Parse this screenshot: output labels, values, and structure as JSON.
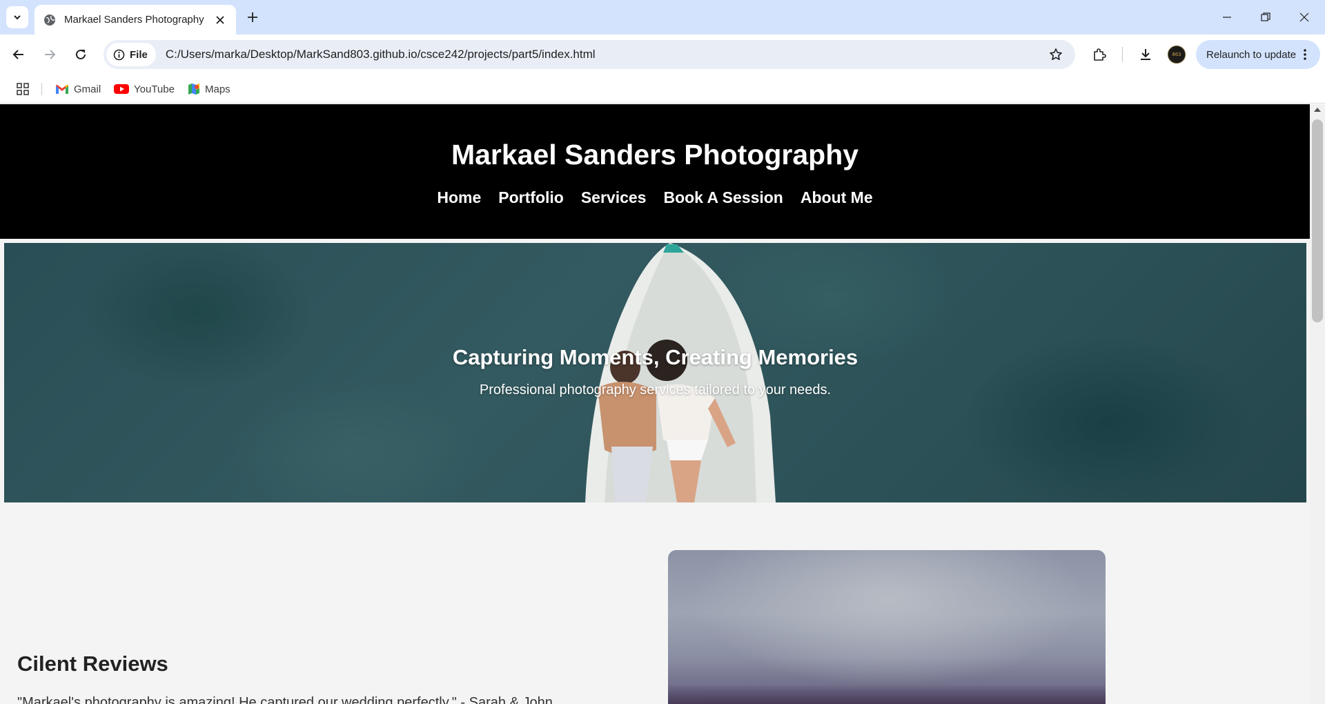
{
  "browser": {
    "tab_title": "Markael Sanders Photography",
    "site_chip_label": "File",
    "url": "C:/Users/marka/Desktop/MarkSand803.github.io/csce242/projects/part5/index.html",
    "profile_initials": "803",
    "relaunch_label": "Relaunch to update",
    "bookmarks": [
      {
        "label": "Gmail",
        "icon": "gmail-icon"
      },
      {
        "label": "YouTube",
        "icon": "youtube-icon"
      },
      {
        "label": "Maps",
        "icon": "maps-icon"
      }
    ],
    "colors": {
      "tabstrip": "#d3e3fd",
      "omnibox": "#e9eef6"
    }
  },
  "site": {
    "title": "Markael Sanders Photography",
    "nav": [
      "Home",
      "Portfolio",
      "Services",
      "Book A Session",
      "About Me"
    ],
    "hero": {
      "heading": "Capturing Moments, Creating Memories",
      "subtext": "Professional photography services tailored to your needs."
    },
    "reviews": {
      "heading": "Cilent Reviews",
      "first_review": "\"Markael's photography is amazing! He captured our wedding perfectly.\" - Sarah & John"
    },
    "colors": {
      "header_bg": "#000000",
      "page_bg": "#f4f4f4",
      "text": "#ffffff"
    }
  }
}
